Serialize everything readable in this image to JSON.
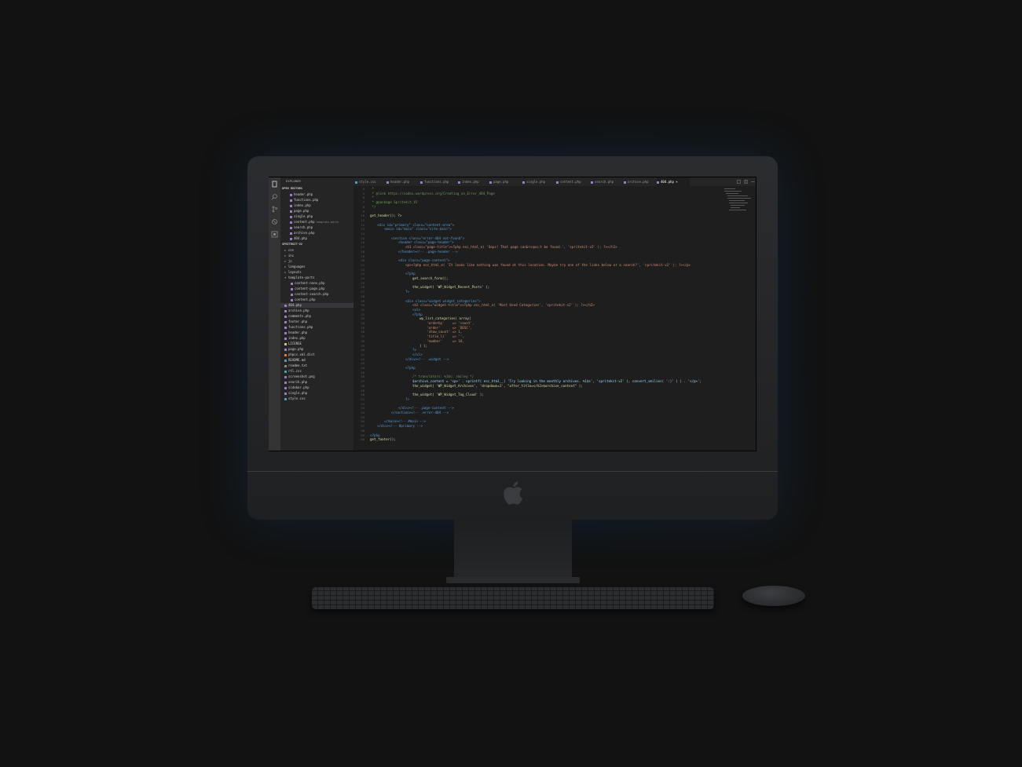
{
  "explorer": {
    "title": "EXPLORER",
    "open_editors_label": "OPEN EDITORS",
    "open_editors": [
      "header.php",
      "functions.php",
      "index.php",
      "page.php",
      "single.php",
      "content.php",
      "search.php",
      "archive.php",
      "404.php"
    ],
    "template_parts_hint": "template-parts",
    "project_label": "SPRITEKIT-V2",
    "folders": [
      "css",
      "inc",
      "js",
      "languages",
      "layouts",
      "template-parts"
    ],
    "template_parts": [
      "content-none.php",
      "content-page.php",
      "content-search.php",
      "content.php"
    ],
    "files": [
      "404.php",
      "archive.php",
      "comments.php",
      "footer.php",
      "functions.php",
      "header.php",
      "index.php",
      "LICENSE",
      "page.php",
      "phpcs.xml.dist",
      "README.md",
      "readme.txt",
      "rtl.css",
      "screenshot.png",
      "search.php",
      "sidebar.php",
      "single.php",
      "style.css"
    ]
  },
  "tabs": [
    "style.css",
    "header.php",
    "functions.php",
    "index.php",
    "page.php",
    "single.php",
    "content.php",
    "search.php",
    "archive.php",
    "404.php"
  ],
  "active_tab_close": "×",
  "code": {
    "line_numbers": [
      "4",
      "5",
      "6",
      "7",
      "8",
      "9",
      "10",
      "11",
      "12",
      "13",
      "14",
      "15",
      "16",
      "17",
      "18",
      "19",
      "20",
      "21",
      "22",
      "23",
      "24",
      "25",
      "26",
      "27",
      "28",
      "29",
      "30",
      "31",
      "32",
      "33",
      "34",
      "35",
      "36",
      "37",
      "38",
      "39",
      "40",
      "41",
      "42",
      "43",
      "44",
      "45",
      "46",
      "47",
      "48",
      "49",
      "50",
      "51",
      "52",
      "53",
      "54",
      "55",
      "56",
      "57",
      "58",
      "59",
      "60"
    ],
    "l1": " *",
    "l2": " * @link https://codex.wordpress.org/Creating_an_Error_404_Page",
    "l3": " *",
    "l4": " * @package Spritekit_V2",
    "l5": " */",
    "l7": "get_header(); ?>",
    "l9a": "<div id=\"primary\" class=\"content-area\">",
    "l10a": "<main id=\"main\" class=\"site-main\">",
    "l12a": "<section class=\"error-404 not-found\">",
    "l13a": "<header class=\"page-header\">",
    "l14a": "<h1 class=\"page-title\"><?php esc_html_e( 'Oops! That page can&rsquo;t be found.', 'spritekit-v2' ); ?></h1>",
    "l15a": "</header><!-- .page-header -->",
    "l17a": "<div class=\"page-content\">",
    "l18a": "<p><?php esc_html_e( 'It looks like nothing was found at this location. Maybe try one of the links below or a search?', 'spritekit-v2' ); ?></p>",
    "l20a": "<?php",
    "l21a": "get_search_form();",
    "l23a": "the_widget( 'WP_Widget_Recent_Posts' );",
    "l24a": "?>",
    "l26a": "<div class=\"widget widget_categories\">",
    "l27a": "<h2 class=\"widget-title\"><?php esc_html_e( 'Most Used Categories', 'spritekit-v2' ); ?></h2>",
    "l28a": "<ul>",
    "l29a": "<?php",
    "l30a": "wp_list_categories( array(",
    "l31a": "'orderby'    => 'count',",
    "l32a": "'order'      => 'DESC',",
    "l33a": "'show_count' => 1,",
    "l34a": "'title_li'   => '',",
    "l35a": "'number'     => 10,",
    "l36a": ") );",
    "l37a": "?>",
    "l38a": "</ul>",
    "l39a": "</div><!-- .widget -->",
    "l41a": "<?php",
    "l43a": "/* translators: %1$s: smiley */",
    "l44a": "$archive_content = '<p>' . sprintf( esc_html__( 'Try looking in the monthly archives. %1$s', 'spritekit-v2' ), convert_smilies( ':)' ) ) . '</p>';",
    "l45a": "the_widget( 'WP_Widget_Archives', 'dropdown=1', \"after_title=</h2>$archive_content\" );",
    "l47a": "the_widget( 'WP_Widget_Tag_Cloud' );",
    "l48a": "?>",
    "l50a": "</div><!-- .page-content -->",
    "l51a": "</section><!-- .error-404 -->",
    "l53a": "</main><!-- #main -->",
    "l54a": "</div><!-- #primary -->",
    "l56a": "<?php",
    "l57a": "get_footer();"
  },
  "colors": {
    "editor_bg": "#1e1e1e",
    "sidebar_bg": "#252526",
    "activity_bg": "#333333",
    "keyword": "#569cd6",
    "string": "#ce9178",
    "comment": "#6a9955"
  }
}
